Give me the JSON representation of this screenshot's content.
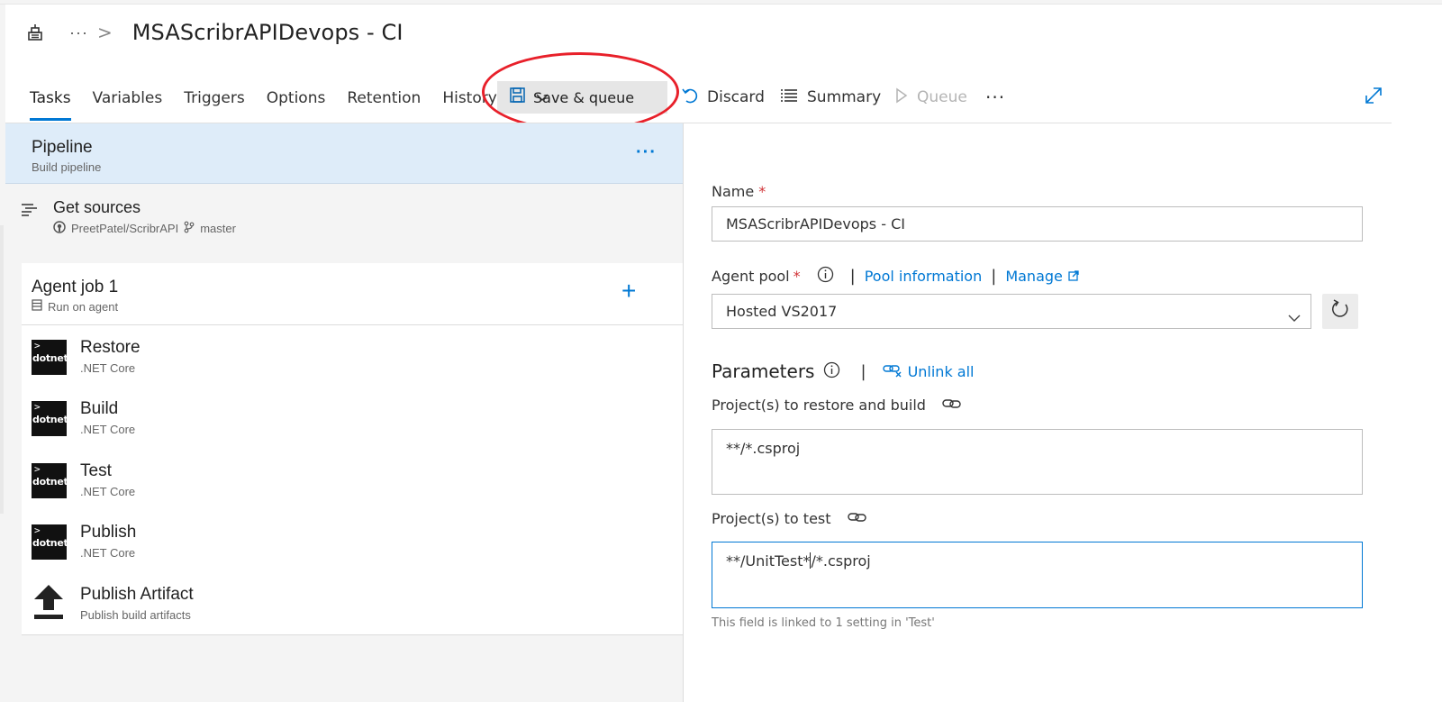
{
  "header": {
    "breadcrumb_more": "···",
    "breadcrumb_separator": ">",
    "title": "MSAScribrAPIDevops - CI"
  },
  "tabs": [
    {
      "label": "Tasks",
      "active": true
    },
    {
      "label": "Variables",
      "active": false
    },
    {
      "label": "Triggers",
      "active": false
    },
    {
      "label": "Options",
      "active": false
    },
    {
      "label": "Retention",
      "active": false
    },
    {
      "label": "History",
      "active": false
    }
  ],
  "toolbar": {
    "save_queue": "Save & queue",
    "discard": "Discard",
    "summary": "Summary",
    "queue": "Queue",
    "more": "···"
  },
  "pipeline": {
    "title": "Pipeline",
    "subtitle": "Build pipeline",
    "more": "···"
  },
  "sources": {
    "title": "Get sources",
    "repo": "PreetPatel/ScribrAPI",
    "branch": "master"
  },
  "agent_job": {
    "title": "Agent job 1",
    "subtitle": "Run on agent",
    "add": "+"
  },
  "tasks": [
    {
      "name": "Restore",
      "type": ".NET Core",
      "icon": "dotnet-icon"
    },
    {
      "name": "Build",
      "type": ".NET Core",
      "icon": "dotnet-icon"
    },
    {
      "name": "Test",
      "type": ".NET Core",
      "icon": "dotnet-icon"
    },
    {
      "name": "Publish",
      "type": ".NET Core",
      "icon": "dotnet-icon"
    },
    {
      "name": "Publish Artifact",
      "type": "Publish build artifacts",
      "icon": "upload-arrow-icon"
    }
  ],
  "dotnet_icon": {
    "prompt": ">",
    "text": "dotnet"
  },
  "form": {
    "name_label": "Name",
    "required_mark": "*",
    "name_value": "MSAScribrAPIDevops - CI",
    "agent_pool_label": "Agent pool",
    "pool_info_link": "Pool information",
    "manage_link": "Manage",
    "separator": "|",
    "agent_pool_value": "Hosted VS2017",
    "parameters_title": "Parameters",
    "unlink_all": "Unlink all",
    "restore_label": "Project(s) to restore and build",
    "restore_value": "**/*.csproj",
    "test_label": "Project(s) to test",
    "test_value_before_caret": "**/UnitTest*",
    "test_value_after_caret": "/*.csproj",
    "test_hint": "This field is linked to 1 setting in 'Test'"
  },
  "colors": {
    "accent": "#0078d4",
    "annotation_oval": "#e8202a",
    "pipeline_selected_bg": "#deecf9",
    "required": "#d13438"
  }
}
